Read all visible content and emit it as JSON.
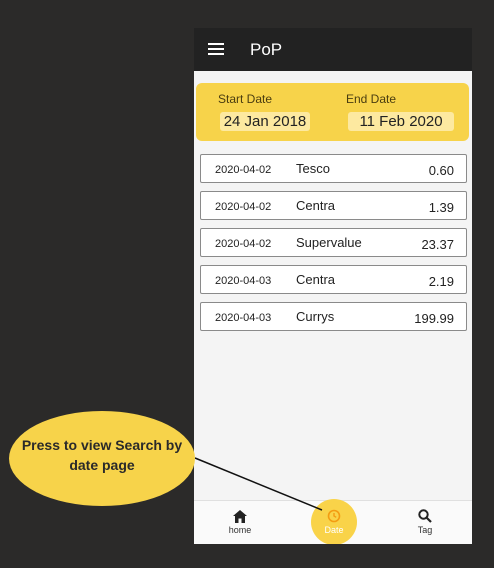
{
  "app": {
    "title": "PoP"
  },
  "date_range": {
    "start_label": "Start Date",
    "start_value": "24 Jan 2018",
    "end_label": "End Date",
    "end_value": "11 Feb 2020"
  },
  "receipts": [
    {
      "date": "2020-04-02",
      "store": "Tesco",
      "amount": "0.60"
    },
    {
      "date": "2020-04-02",
      "store": "Centra",
      "amount": "1.39"
    },
    {
      "date": "2020-04-02",
      "store": "Supervalue",
      "amount": "23.37"
    },
    {
      "date": "2020-04-03",
      "store": "Centra",
      "amount": "2.19"
    },
    {
      "date": "2020-04-03",
      "store": "Currys",
      "amount": "199.99"
    }
  ],
  "bottom_nav": [
    {
      "label": "home",
      "icon": "home-icon"
    },
    {
      "label": "Date",
      "icon": "history-icon"
    },
    {
      "label": "Tag",
      "icon": "search-icon"
    }
  ],
  "callout": {
    "line1": "Press to view Search by",
    "line2": "date page"
  },
  "colors": {
    "accent": "#f7d34a",
    "appbar": "#222222",
    "background": "#2b2a29"
  }
}
